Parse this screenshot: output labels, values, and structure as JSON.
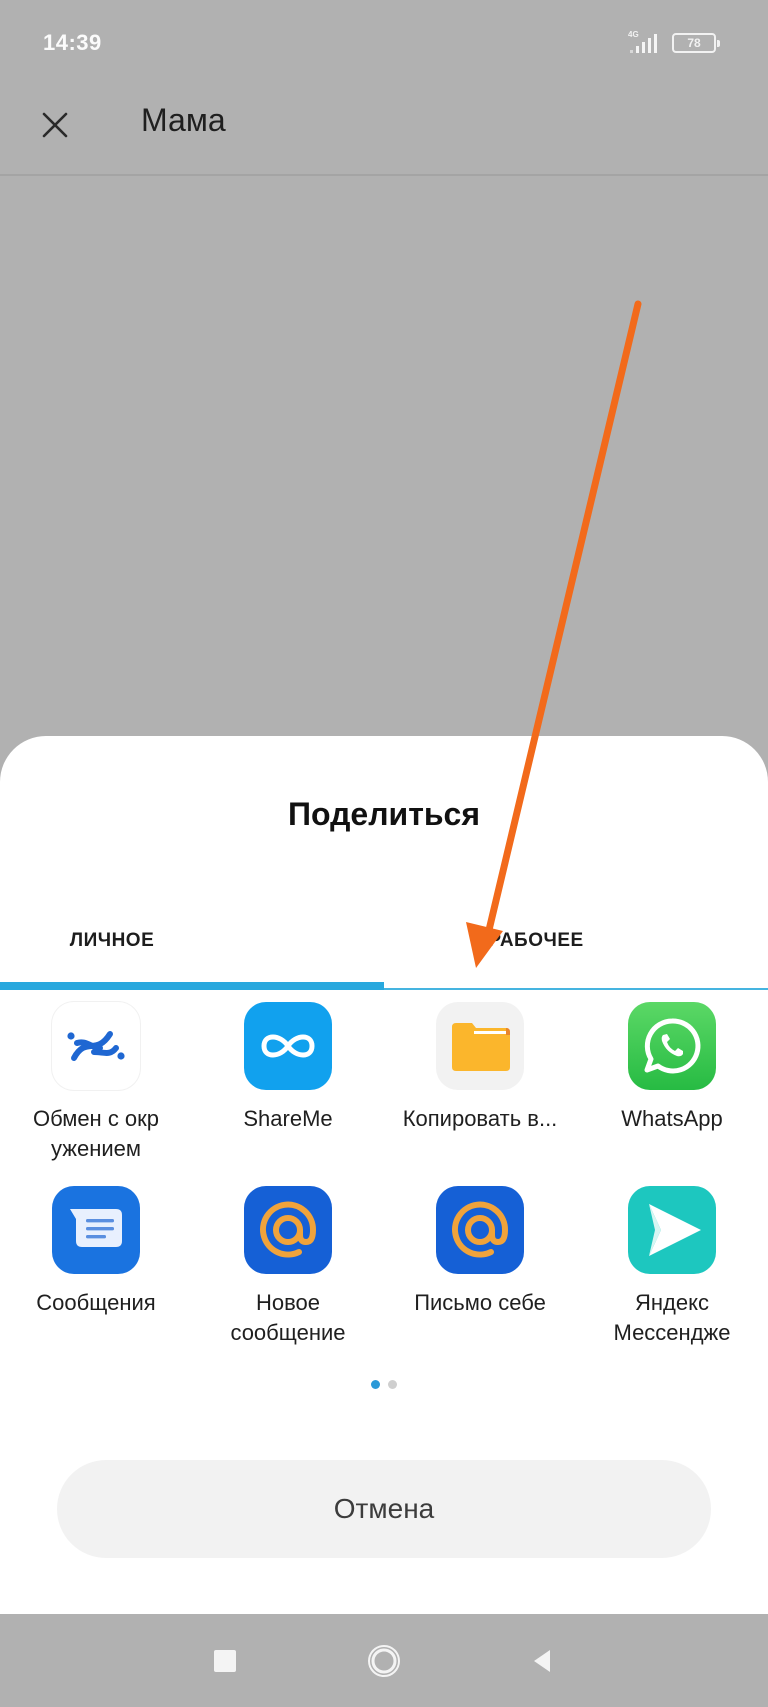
{
  "status_bar": {
    "time": "14:39",
    "network": "4G",
    "battery": "78"
  },
  "header": {
    "title": "Мама",
    "close_icon": "close-icon"
  },
  "share_sheet": {
    "title": "Поделиться",
    "tabs": [
      {
        "label": "ЛИЧНОЕ",
        "active": true
      },
      {
        "label": "РАБОЧЕЕ",
        "active": false
      }
    ],
    "apps": [
      {
        "label": "Обмен с окр ужением",
        "icon": "nearby-share-icon"
      },
      {
        "label": "ShareMe",
        "icon": "shareme-icon"
      },
      {
        "label": "Копировать в...",
        "icon": "folder-icon"
      },
      {
        "label": "WhatsApp",
        "icon": "whatsapp-icon"
      },
      {
        "label": "Сообщения",
        "icon": "messages-icon"
      },
      {
        "label": "Новое сообщение",
        "icon": "mail-at-icon"
      },
      {
        "label": "Письмо себе",
        "icon": "mail-at-icon"
      },
      {
        "label": "Яндекс Мессендже",
        "icon": "yandex-messenger-icon"
      }
    ],
    "pager": {
      "current_page": 1,
      "total_pages": 2
    },
    "cancel_label": "Отмена"
  },
  "annotation": {
    "type": "arrow",
    "color": "#f26a1b",
    "points_to": "Копировать в..."
  },
  "colors": {
    "accent": "#28a8de",
    "scrim": "#b1b1b1"
  }
}
